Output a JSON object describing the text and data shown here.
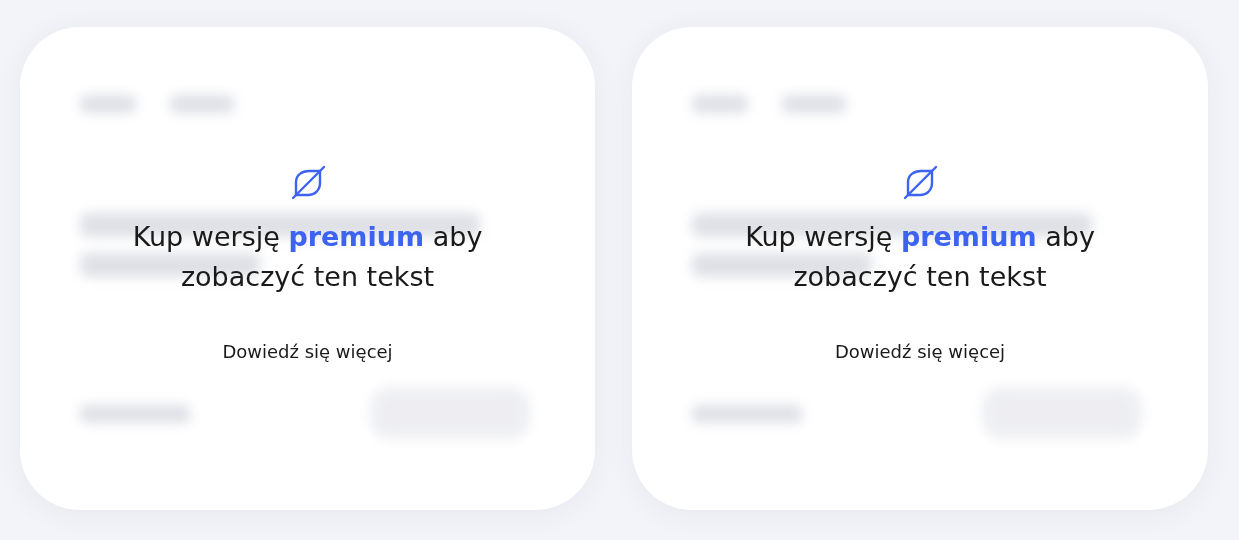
{
  "cards": [
    {
      "message": "Kup wersję **premium** aby zobaczyć ten tekst",
      "link": "Dowiedź się więcej"
    },
    {
      "message": "Kup wersję **premium** aby zobaczyć ten tekst",
      "link": "Dowiedź się więcej"
    }
  ]
}
